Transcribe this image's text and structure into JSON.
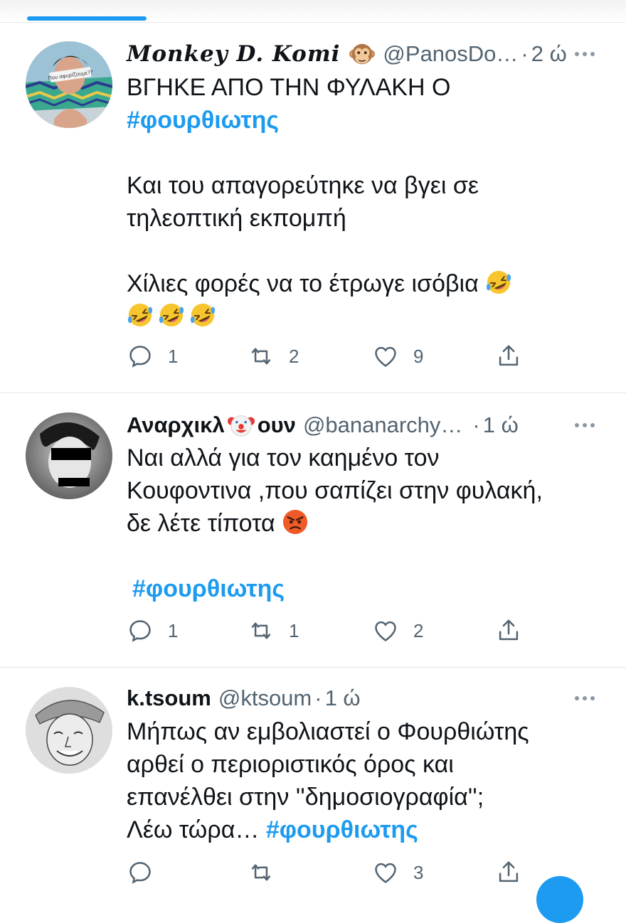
{
  "tweets": [
    {
      "display_name": "Monkey D. Komi",
      "name_emoji": "monkey-face",
      "handle": "@PanosDo…",
      "separator": "·",
      "time": "2 ώ",
      "lines": [
        "ΒΓΗΚΕ ΑΠΟ ΤΗΝ ΦΥΛΑΚΗ Ο"
      ],
      "hashtag": "#φουρθιωτης",
      "lines_2": [
        "Και του απαγορεύτηκε να βγει σε",
        "τηλεοπτική εκπομπή"
      ],
      "line_3": "Χίλιες φορές να το έτρωγε ισόβια",
      "emoji_icons": [
        "rofl",
        "rofl",
        "rofl",
        "rofl"
      ],
      "replies": "1",
      "retweets": "2",
      "likes": "9",
      "avatar_caption": "Που σφυρίζουμε??"
    },
    {
      "display_name_part1": "Αναρχικλ",
      "name_emoji": "clown-face",
      "display_name_part2": "ουν",
      "handle": "@bananarchy…",
      "separator": "·",
      "time": "1 ώ",
      "lines": [
        "Ναι αλλά για τον καημένο τον",
        "Κουφοντινα ,που σαπίζει στην φυλακή,",
        "δε λέτε τίποτα"
      ],
      "emoji_icons": [
        "angry-face"
      ],
      "hashtag": "#φουρθιωτης",
      "replies": "1",
      "retweets": "1",
      "likes": "2"
    },
    {
      "display_name": "k.tsoum",
      "handle": "@ktsoum",
      "separator": "·",
      "time": "1 ώ",
      "lines": [
        "Μήπως αν εμβολιαστεί ο Φουρθιώτης",
        "αρθεί ο περιοριστικός όρος και",
        "επανέλθει  στην ''δημοσιογραφία'';"
      ],
      "last_line_prefix": "Λέω τώρα… ",
      "hashtag": "#φουρθιωτης",
      "likes": "3"
    }
  ],
  "colors": {
    "accent": "#1d9bf0",
    "text": "#0f1419",
    "muted": "#536471",
    "divider": "#e1e4e7"
  }
}
